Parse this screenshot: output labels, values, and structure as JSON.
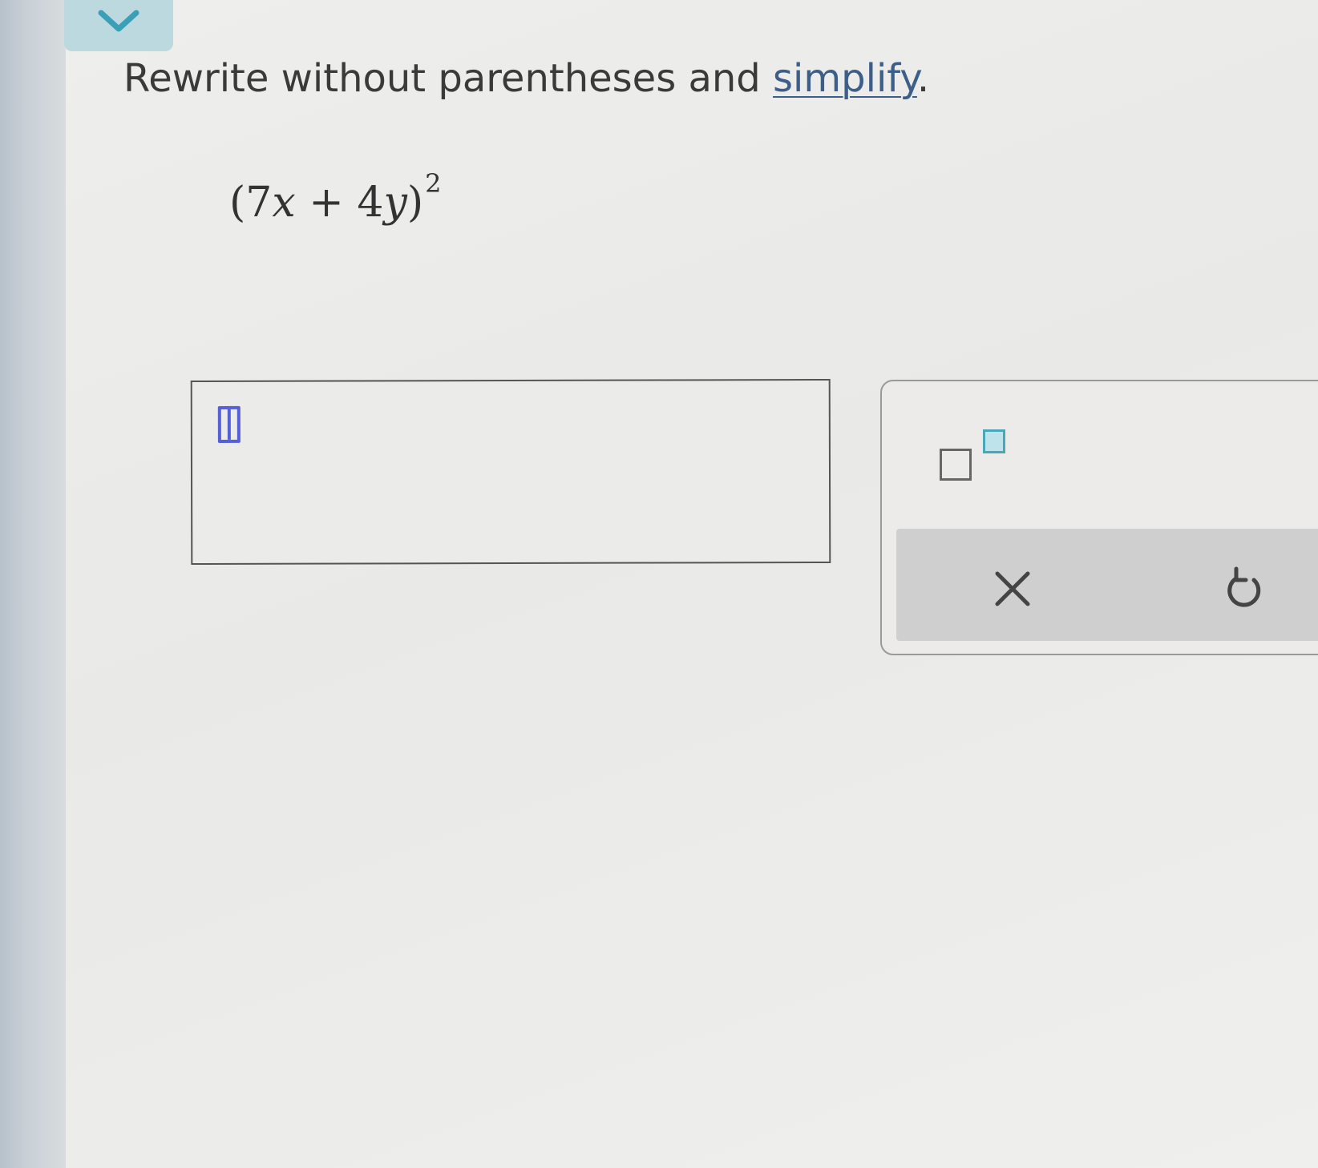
{
  "question": {
    "instruction_prefix": "Rewrite without parentheses and ",
    "instruction_link": "simplify",
    "instruction_suffix": ".",
    "expression": {
      "open_paren": "(",
      "coef1": "7",
      "var1": "x",
      "operator": "+",
      "coef2": "4",
      "var2": "y",
      "close_paren": ")",
      "exponent": "2"
    }
  },
  "answer": {
    "value": ""
  },
  "icons": {
    "collapse": "chevron-down-icon",
    "superscript": "superscript-template-icon",
    "clear": "close-icon",
    "undo": "undo-icon"
  },
  "colors": {
    "accent": "#5560d8",
    "link": "#3d5e89",
    "tab": "#bcd9df",
    "superscript_highlight": "#4aa7b7"
  }
}
